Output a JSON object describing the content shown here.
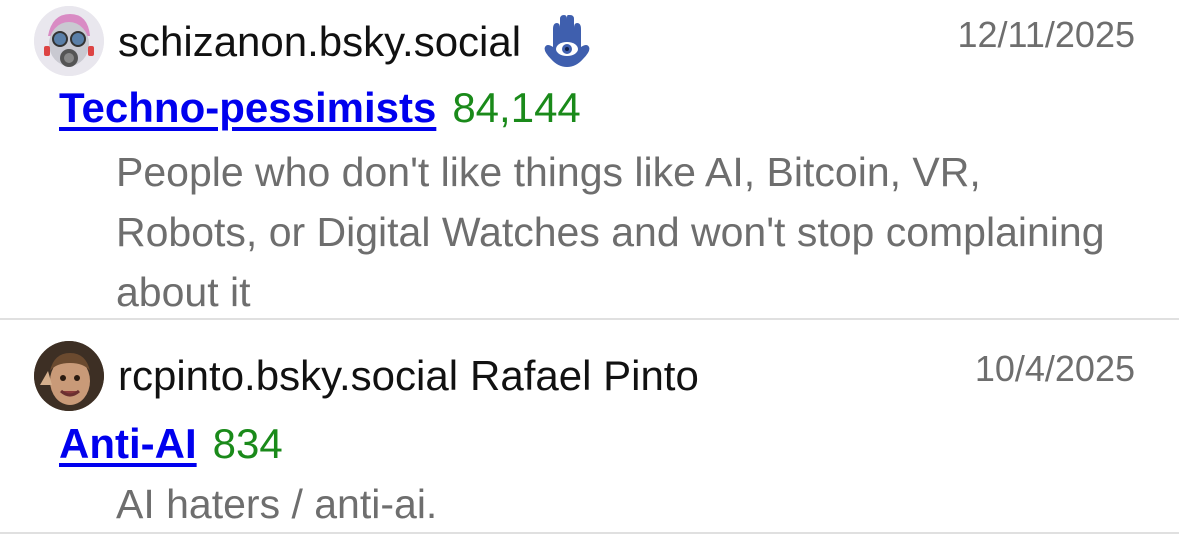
{
  "entries": [
    {
      "handle": "schizanon.bsky.social",
      "display_name": "",
      "badge_icon": "hamsa-icon",
      "date": "12/11/2025",
      "list_name": "Techno-pessimists",
      "member_count": "84,144",
      "description": "People who don't like things like AI, Bitcoin, VR, Robots, or Digital Watches and won't stop complaining about it"
    },
    {
      "handle": "rcpinto.bsky.social",
      "display_name": "Rafael Pinto",
      "date": "10/4/2025",
      "list_name": "Anti-AI",
      "member_count": "834",
      "description": "AI haters / anti-ai."
    }
  ],
  "colors": {
    "link": "#0000ee",
    "count": "#1a8a1a",
    "muted": "#6e6e6e",
    "divider": "#e0e0e0",
    "hamsa": "#3f5fae"
  }
}
